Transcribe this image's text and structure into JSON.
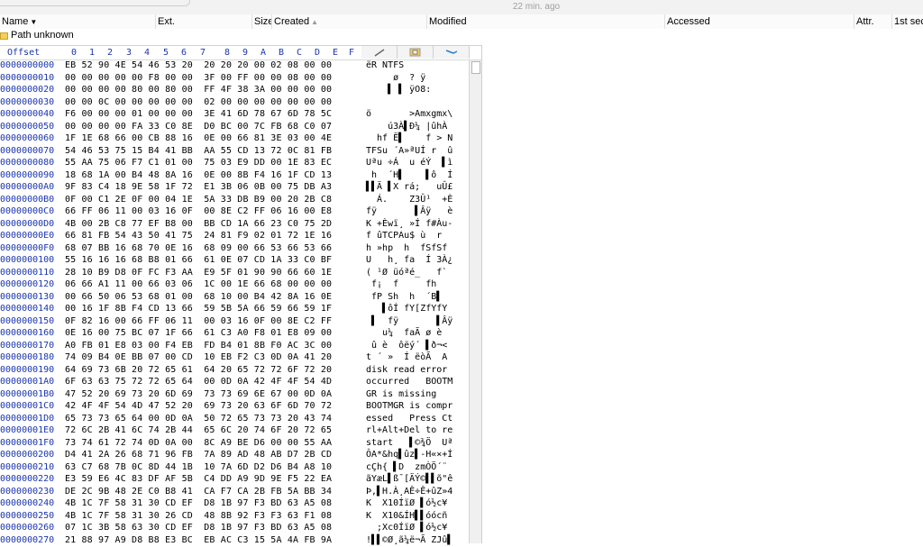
{
  "topbar": {
    "time": "22 min. ago"
  },
  "columns": [
    {
      "label": "Name",
      "sort": "down"
    },
    {
      "label": "Ext.",
      "sort": ""
    },
    {
      "label": "Size",
      "sort": ""
    },
    {
      "label": "Created",
      "sort": "up"
    },
    {
      "label": "Modified",
      "sort": ""
    },
    {
      "label": "Accessed",
      "sort": ""
    },
    {
      "label": "Attr.",
      "sort": ""
    },
    {
      "label": "1st sector",
      "sort": ""
    }
  ],
  "path": {
    "label": "Path unknown",
    "icon": "folder-icon"
  },
  "hex": {
    "offset_label": "Offset",
    "byte_headers": [
      "0",
      "1",
      "2",
      "3",
      "4",
      "5",
      "6",
      "7",
      "8",
      "9",
      "A",
      "B",
      "C",
      "D",
      "E",
      "F"
    ],
    "toolbar_icons": [
      "pencil-icon",
      "palette-icon",
      "arrow-icon"
    ],
    "rows": [
      {
        "o": "0000000000",
        "h": "EB 52 90 4E 54 46 53 20  20 20 20 00 02 08 00 00",
        "t": "ëR NTFS"
      },
      {
        "o": "0000000010",
        "h": "00 00 00 00 00 F8 00 00  3F 00 FF 00 00 08 00 00",
        "t": "     ø  ? ÿ"
      },
      {
        "o": "0000000020",
        "h": "00 00 00 00 80 00 80 00  FF 4F 38 3A 00 00 00 00",
        "t": "    ▌ ▌ ÿO8:"
      },
      {
        "o": "0000000030",
        "h": "00 00 0C 00 00 00 00 00  02 00 00 00 00 00 00 00",
        "t": ""
      },
      {
        "o": "0000000040",
        "h": "F6 00 00 00 01 00 00 00  3E 41 6D 78 67 6D 78 5C",
        "t": "ö       >Amxgmx\\"
      },
      {
        "o": "0000000050",
        "h": "00 00 00 00 FA 33 C0 8E  D0 BC 00 7C FB 68 C0 07",
        "t": "    ú3À▌Ð¼ |ûhÀ"
      },
      {
        "o": "0000000060",
        "h": "1F 1E 68 66 00 CB 88 16  0E 00 66 81 3E 03 00 4E",
        "t": "  hf Ë▌    f > N"
      },
      {
        "o": "0000000070",
        "h": "54 46 53 75 15 B4 41 BB  AA 55 CD 13 72 0C 81 FB",
        "t": "TFSu ´A»ªUÍ r  û"
      },
      {
        "o": "0000000080",
        "h": "55 AA 75 06 F7 C1 01 00  75 03 E9 DD 00 1E 83 EC",
        "t": "Uªu ÷Á  u éÝ  ▌ì"
      },
      {
        "o": "0000000090",
        "h": "18 68 1A 00 B4 48 8A 16  0E 00 8B F4 16 1F CD 13",
        "t": " h  ´H▌    ▌ô  Í"
      },
      {
        "o": "00000000A0",
        "h": "9F 83 C4 18 9E 58 1F 72  E1 3B 06 0B 00 75 DB A3",
        "t": "▌▌Ä ▌X rá;   uÛ£"
      },
      {
        "o": "00000000B0",
        "h": "0F 00 C1 2E 0F 00 04 1E  5A 33 DB B9 00 20 2B C8",
        "t": "  Á.    Z3Û¹  +È"
      },
      {
        "o": "00000000C0",
        "h": "66 FF 06 11 00 03 16 0F  00 8E C2 FF 06 16 00 E8",
        "t": "fÿ       ▌Âÿ   è"
      },
      {
        "o": "00000000D0",
        "h": "4B 00 2B C8 77 EF B8 00  BB CD 1A 66 23 C0 75 2D",
        "t": "K +Èwï¸ »Í f#Àu-"
      },
      {
        "o": "00000000E0",
        "h": "66 81 FB 54 43 50 41 75  24 81 F9 02 01 72 1E 16",
        "t": "f ûTCPAu$ ù  r"
      },
      {
        "o": "00000000F0",
        "h": "68 07 BB 16 68 70 0E 16  68 09 00 66 53 66 53 66",
        "t": "h »hp  h  fSfSf"
      },
      {
        "o": "0000000100",
        "h": "55 16 16 16 68 B8 01 66  61 0E 07 CD 1A 33 C0 BF",
        "t": "U   h¸ fa  Í 3À¿"
      },
      {
        "o": "0000000110",
        "h": "28 10 B9 D8 0F FC F3 AA  E9 5F 01 90 90 66 60 1E",
        "t": "( ¹Ø üóªé_   f`"
      },
      {
        "o": "0000000120",
        "h": "06 66 A1 11 00 66 03 06  1C 00 1E 66 68 00 00 00",
        "t": " f¡  f     fh"
      },
      {
        "o": "0000000130",
        "h": "00 66 50 06 53 68 01 00  68 10 00 B4 42 8A 16 0E",
        "t": " fP Sh  h  ´B▌"
      },
      {
        "o": "0000000140",
        "h": "00 16 1F 8B F4 CD 13 66  59 5B 5A 66 59 66 59 1F",
        "t": "   ▌ôÍ fY[ZfYfY"
      },
      {
        "o": "0000000150",
        "h": "0F 82 16 00 66 FF 06 11  00 03 16 0F 00 8E C2 FF",
        "t": " ▌  fÿ       ▌Âÿ"
      },
      {
        "o": "0000000160",
        "h": "0E 16 00 75 BC 07 1F 66  61 C3 A0 F8 01 E8 09 00",
        "t": "   u¼  faÃ ø è"
      },
      {
        "o": "0000000170",
        "h": "A0 FB 01 E8 03 00 F4 EB  FD B4 01 8B F0 AC 3C 00",
        "t": " û è  ôëý´ ▌ð¬<"
      },
      {
        "o": "0000000180",
        "h": "74 09 B4 0E BB 07 00 CD  10 EB F2 C3 0D 0A 41 20",
        "t": "t ´ »  Í ëòÃ  A"
      },
      {
        "o": "0000000190",
        "h": "64 69 73 6B 20 72 65 61  64 20 65 72 72 6F 72 20",
        "t": "disk read error"
      },
      {
        "o": "00000001A0",
        "h": "6F 63 63 75 72 72 65 64  00 0D 0A 42 4F 4F 54 4D",
        "t": "occurred   BOOTM"
      },
      {
        "o": "00000001B0",
        "h": "47 52 20 69 73 20 6D 69  73 73 69 6E 67 00 0D 0A",
        "t": "GR is missing"
      },
      {
        "o": "00000001C0",
        "h": "42 4F 4F 54 4D 47 52 20  69 73 20 63 6F 6D 70 72",
        "t": "BOOTMGR is compr"
      },
      {
        "o": "00000001D0",
        "h": "65 73 73 65 64 00 0D 0A  50 72 65 73 73 20 43 74",
        "t": "essed   Press Ct"
      },
      {
        "o": "00000001E0",
        "h": "72 6C 2B 41 6C 74 2B 44  65 6C 20 74 6F 20 72 65",
        "t": "rl+Alt+Del to re"
      },
      {
        "o": "00000001F0",
        "h": "73 74 61 72 74 0D 0A 00  8C A9 BE D6 00 00 55 AA",
        "t": "start   ▌©¾Ö  Uª"
      },
      {
        "o": "0000000200",
        "h": "D4 41 2A 26 68 71 96 FB  7A 89 AD 48 AB D7 2B CD",
        "t": "ÔA*&hq▌ûz▌-H«×+Í"
      },
      {
        "o": "0000000210",
        "h": "63 C7 68 7B 0C 8D 44 1B  10 7A 6D D2 D6 B4 A8 10",
        "t": "cÇh{ ▌D  zmÒÖ´¨"
      },
      {
        "o": "0000000220",
        "h": "E3 59 E6 4C 83 DF AF 5B  C4 DD A9 9D 9E F5 22 EA",
        "t": "ãYæL▌ß¯[ÄÝ©▌▌õ\"ê"
      },
      {
        "o": "0000000230",
        "h": "DE 2C 9B 48 2E C0 B8 41  CA F7 CA 2B FB 5A BB 34",
        "t": "Þ,▌H.À¸AÊ÷Ê+ûZ»4"
      },
      {
        "o": "0000000240",
        "h": "4B 1C 7F 58 31 30 CD EF  D8 1B 97 F3 BD 63 A5 08",
        "t": "K  X10ÍïØ ▌ó½c¥"
      },
      {
        "o": "0000000250",
        "h": "4B 1C 7F 58 31 30 26 CD  48 8B 92 F3 F3 63 F1 08",
        "t": "K  X10&ÍH▌▌óócñ"
      },
      {
        "o": "0000000260",
        "h": "07 1C 3B 58 63 30 CD EF  D8 1B 97 F3 BD 63 A5 08",
        "t": "  ;Xc0ÍïØ ▌ó½c¥"
      },
      {
        "o": "0000000270",
        "h": "21 88 97 A9 D8 B8 E3 BC  EB AC C3 15 5A 4A FB 9A",
        "t": "!▌▌©Ø¸ã¼ë¬Ã ZJû▌"
      }
    ]
  }
}
